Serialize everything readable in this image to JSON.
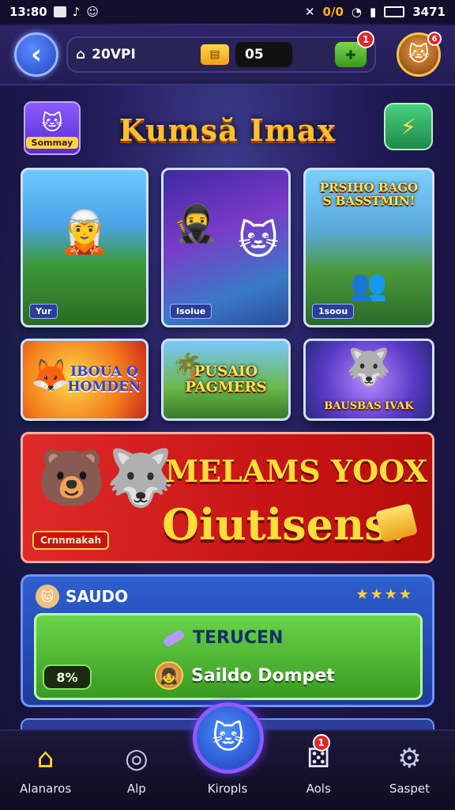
{
  "status_bar": {
    "time": "13:80",
    "right_text": "0/0",
    "clock": "3471"
  },
  "header": {
    "back_label": "‹",
    "coins": "20VPI",
    "count": "05",
    "add_badge": "1",
    "avatar_badge": "6"
  },
  "title_row": {
    "sticker_label": "Sommay",
    "title": "Kumsă Imax"
  },
  "cards": [
    {
      "tag": "Yur",
      "text": ""
    },
    {
      "tag": "Isoiue",
      "text": ""
    },
    {
      "tag": "1soou",
      "text": "PRSIHO BAGO S BASSTMIN!"
    },
    {
      "tag": "",
      "text": "IBOUA Q HOMDEN"
    },
    {
      "tag": "",
      "text": "PUSAIO PAGMERS"
    },
    {
      "tag": "",
      "text": "BAUSBAS IVAK"
    }
  ],
  "promo": {
    "chip": "Crnnmakah",
    "line1": "MELAMS YOOX",
    "line2": "Oiutisens!"
  },
  "saldo": {
    "title": "SAUDO",
    "stars": "★★★★",
    "row1": "TERUCEN",
    "percent": "8%",
    "deposit": "Saildo Dompet"
  },
  "nav": [
    {
      "label": "Alanaros",
      "icon": "home-icon"
    },
    {
      "label": "Alp",
      "icon": "target-icon"
    },
    {
      "label": "Kiropls",
      "icon": "cat-icon"
    },
    {
      "label": "Aols",
      "icon": "dice-icon",
      "badge": "1"
    },
    {
      "label": "Saspet",
      "icon": "gear-icon"
    }
  ],
  "colors": {
    "accent": "#ffc12a",
    "promo_red": "#e02a2a",
    "panel_blue": "#2d5fd0",
    "panel_green": "#6ad44a"
  }
}
